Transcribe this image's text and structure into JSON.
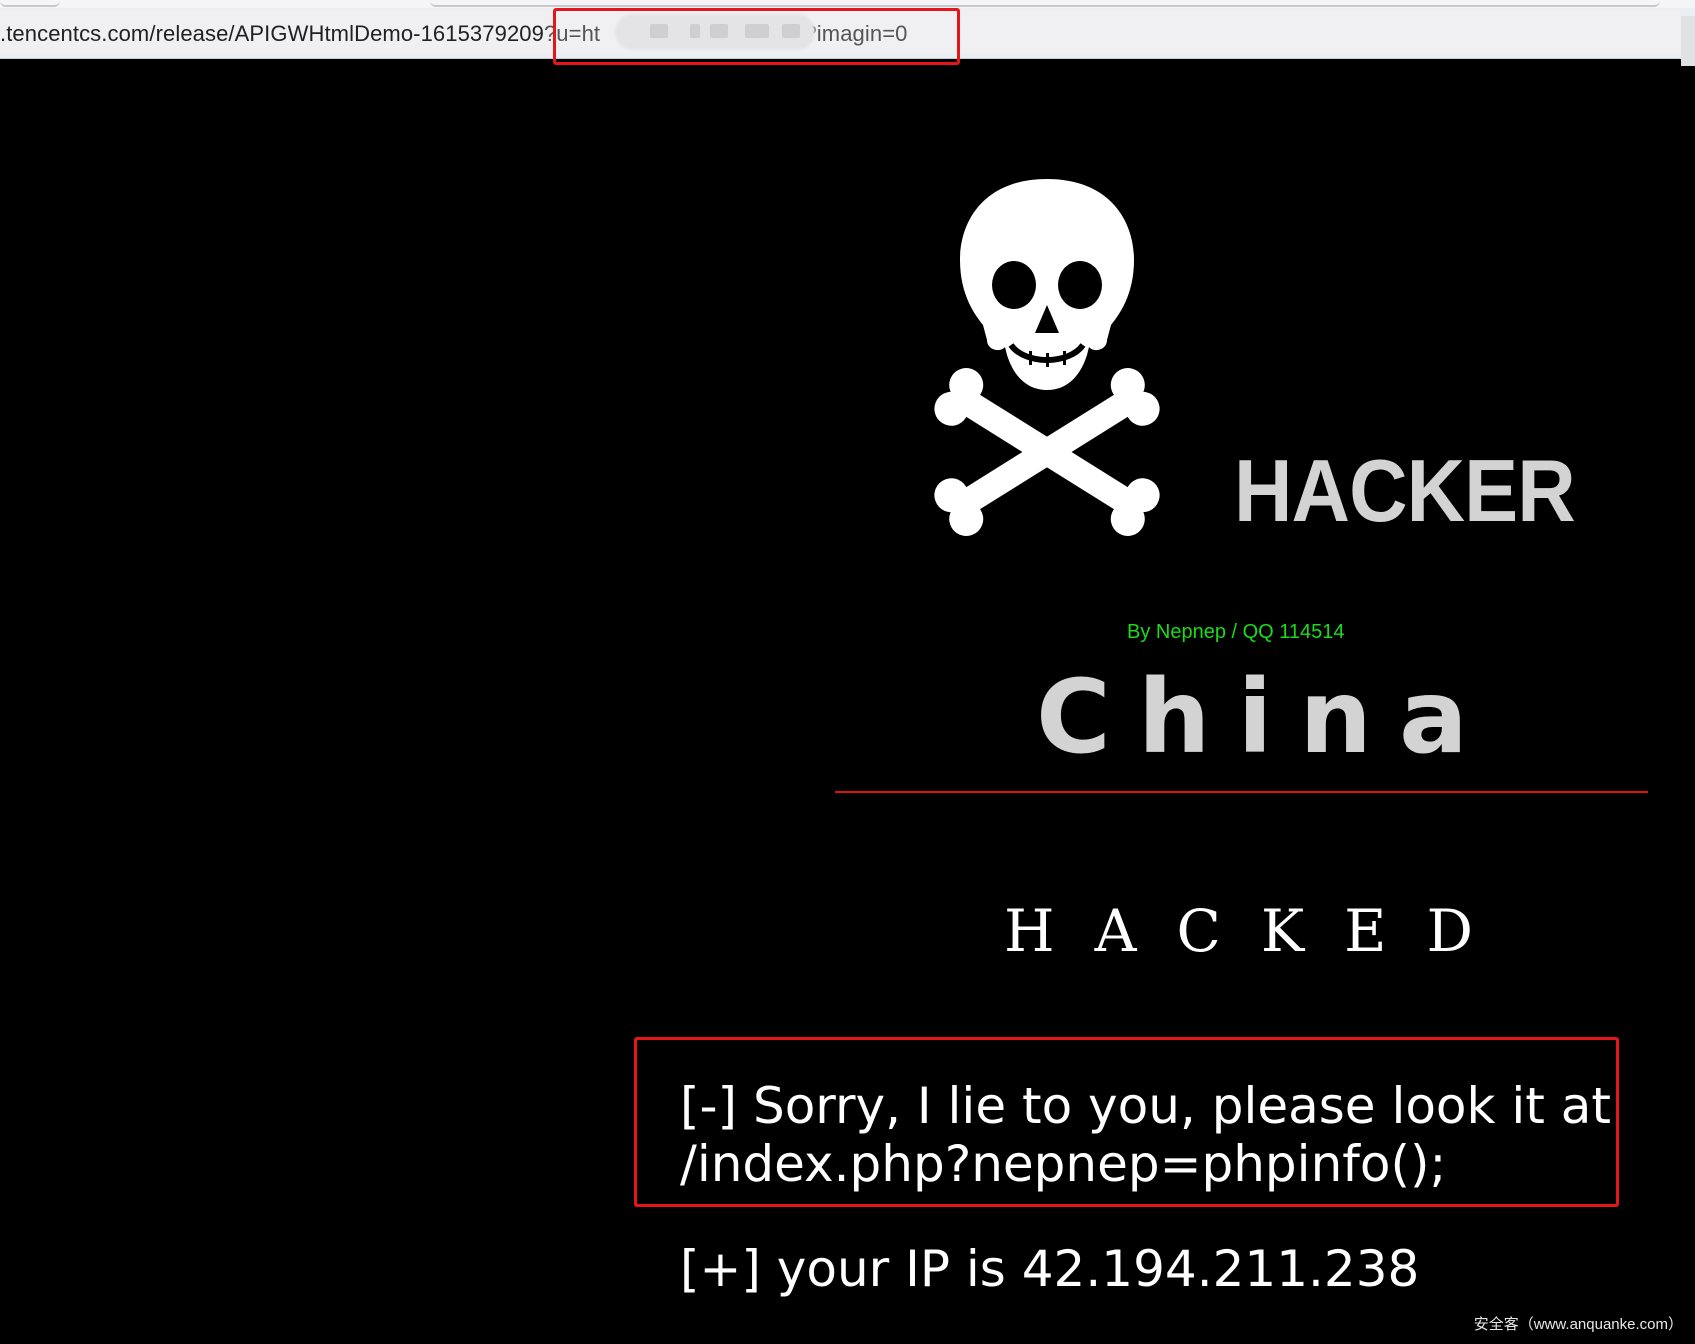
{
  "browser": {
    "url_prefix": ".tencentcs.com/release/APIGWHtmlDemo-1615379209",
    "url_param_start": "?u=ht",
    "url_param_end": "0?imagin=0"
  },
  "page": {
    "hacker_title": "HACKER",
    "byline": "By Nepnep / QQ 114514",
    "china": "China",
    "hacked": "HACKED",
    "message_line1": "[-] Sorry, I lie to you, please look it at",
    "message_line2": "/index.php?nepnep=phpinfo();",
    "ip_line": "[+] your IP is 42.194.211.238",
    "watermark": "安全客（www.anquanke.com）"
  },
  "colors": {
    "background": "#000000",
    "title_gray": "#d3d3d3",
    "byline_green": "#1adb1a",
    "divider_red": "#e01010",
    "highlight_red": "#e4161b"
  },
  "icons": [
    "skull-crossbones-icon"
  ]
}
